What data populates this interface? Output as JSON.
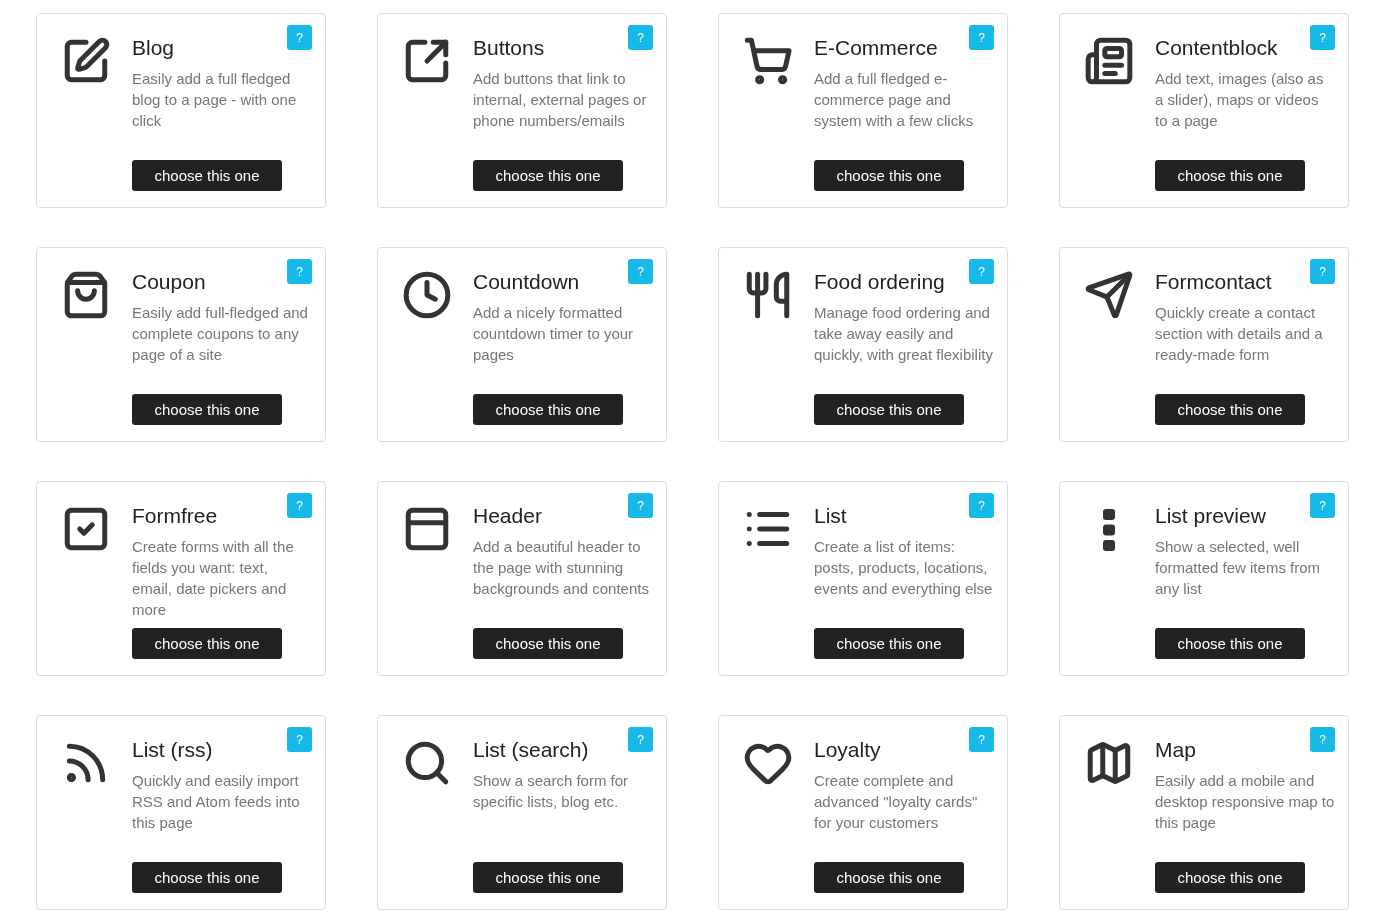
{
  "cards": [
    {
      "title": "Blog",
      "description": "Easily add a full fledged blog to a page - with one click",
      "help": "?",
      "button": "choose this one"
    },
    {
      "title": "Buttons",
      "description": "Add buttons that link to internal, external pages or phone numbers/emails",
      "help": "?",
      "button": "choose this one"
    },
    {
      "title": "E-Commerce",
      "description": "Add a full fledged e-commerce page and system with a few clicks",
      "help": "?",
      "button": "choose this one"
    },
    {
      "title": "Contentblock",
      "description": "Add text, images (also as a slider), maps or videos to a page",
      "help": "?",
      "button": "choose this one"
    },
    {
      "title": "Coupon",
      "description": "Easily add full-fledged and complete coupons to any page of a site",
      "help": "?",
      "button": "choose this one"
    },
    {
      "title": "Countdown",
      "description": "Add a nicely formatted countdown timer to your pages",
      "help": "?",
      "button": "choose this one"
    },
    {
      "title": "Food ordering",
      "description": "Manage food ordering and take away easily and quickly, with great flexibility",
      "help": "?",
      "button": "choose this one"
    },
    {
      "title": "Formcontact",
      "description": "Quickly create a contact section with details and a ready-made form",
      "help": "?",
      "button": "choose this one"
    },
    {
      "title": "Formfree",
      "description": "Create forms with all the fields you want: text, email, date pickers and more",
      "help": "?",
      "button": "choose this one"
    },
    {
      "title": "Header",
      "description": "Add a beautiful header to the page with stunning backgrounds and contents",
      "help": "?",
      "button": "choose this one"
    },
    {
      "title": "List",
      "description": "Create a list of items: posts, products, locations, events and everything else",
      "help": "?",
      "button": "choose this one"
    },
    {
      "title": "List preview",
      "description": "Show a selected, well formatted few items from any list",
      "help": "?",
      "button": "choose this one"
    },
    {
      "title": "List (rss)",
      "description": "Quickly and easily import RSS and Atom feeds into this page",
      "help": "?",
      "button": "choose this one"
    },
    {
      "title": "List (search)",
      "description": "Show a search form for specific lists, blog etc.",
      "help": "?",
      "button": "choose this one"
    },
    {
      "title": "Loyalty",
      "description": "Create complete and advanced \"loyalty cards\" for your customers",
      "help": "?",
      "button": "choose this one"
    },
    {
      "title": "Map",
      "description": "Easily add a mobile and desktop responsive map to this page",
      "help": "?",
      "button": "choose this one"
    }
  ]
}
